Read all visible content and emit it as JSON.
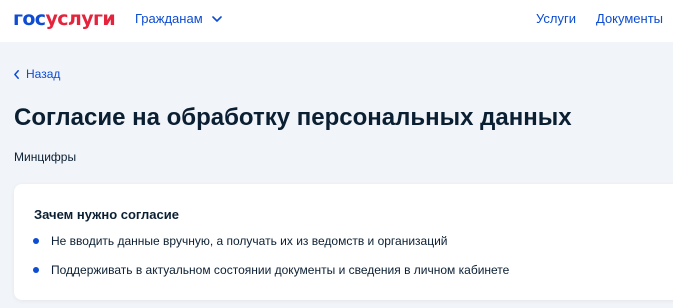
{
  "header": {
    "logo_part1": "гос",
    "logo_part2": "услуги",
    "citizens_dropdown": "Гражданам",
    "services_link": "Услуги",
    "documents_link": "Документы"
  },
  "back_label": "Назад",
  "page_title": "Согласие на обработку персональных данных",
  "ministry": "Минцифры",
  "consent_card": {
    "heading": "Зачем нужно согласие",
    "items": [
      "Не вводить данные вручную, а получать их из ведомств и организаций",
      "Поддерживать в актуальном состоянии документы и сведения в личном кабинете"
    ]
  },
  "colors": {
    "brand_blue": "#0d4cd3",
    "brand_red": "#e4243c",
    "text": "#0b1f33",
    "background": "#f1f4f8"
  },
  "icons": {
    "dropdown": "chevron-down-icon",
    "back": "chevron-left-icon",
    "bullet": "bullet-dot-icon"
  }
}
